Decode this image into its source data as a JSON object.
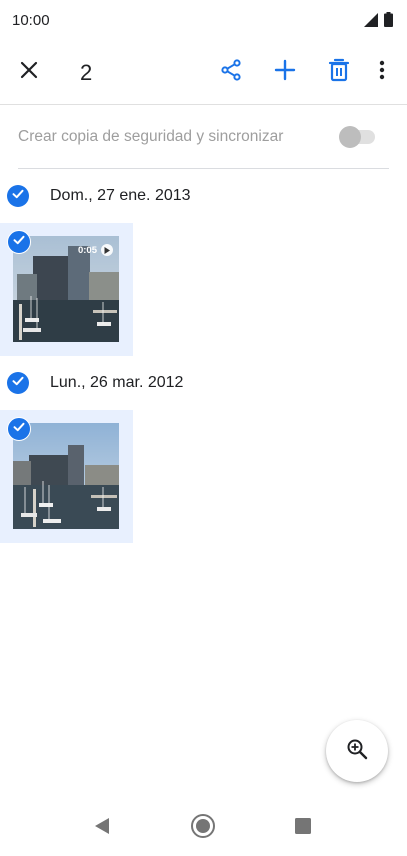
{
  "status_bar": {
    "time": "10:00",
    "icons": [
      "signal-icon",
      "battery-icon"
    ]
  },
  "toolbar": {
    "selected_count": "2",
    "icons": [
      "close-icon",
      "share-icon",
      "add-icon",
      "delete-icon",
      "more-vert-icon"
    ],
    "accent_color": "#1a73e8"
  },
  "backup": {
    "label": "Crear copia de seguridad y sincronizar",
    "toggle_on": false
  },
  "groups": [
    {
      "date": "Dom., 27 ene. 2013",
      "selected": true,
      "items": [
        {
          "type": "video",
          "duration": "0:05",
          "selected": true
        }
      ]
    },
    {
      "date": "Lun., 26 mar. 2012",
      "selected": true,
      "items": [
        {
          "type": "photo",
          "selected": true
        }
      ]
    }
  ],
  "fab": {
    "icon": "zoom-in-icon"
  },
  "nav_bar": {
    "icons": [
      "back-icon",
      "home-icon",
      "recents-icon"
    ]
  }
}
